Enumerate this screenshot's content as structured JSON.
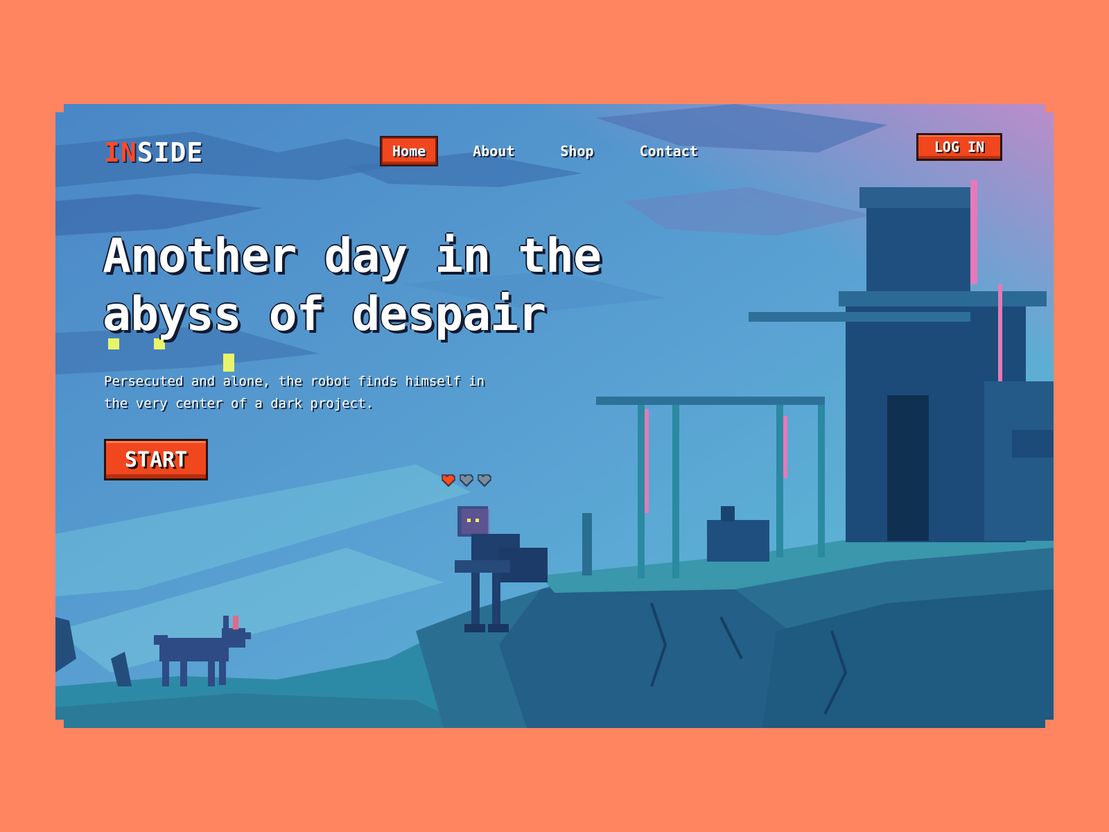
{
  "logo": {
    "accent": "IN",
    "rest": "SIDE"
  },
  "nav": {
    "items": [
      {
        "label": "Home",
        "active": true
      },
      {
        "label": "About",
        "active": false
      },
      {
        "label": "Shop",
        "active": false
      },
      {
        "label": "Contact",
        "active": false
      }
    ]
  },
  "header": {
    "login_label": "LOG IN"
  },
  "hero": {
    "title_line1": "Another day in the",
    "title_line2": "abyss of despair",
    "subtitle_line1": "Persecuted and alone, the robot finds himself in",
    "subtitle_line2": "the very center of a dark project.",
    "start_label": "START"
  },
  "lives": {
    "total": 3,
    "filled": 1
  },
  "colors": {
    "background": "#ff8560",
    "accent": "#f0471f",
    "sky": "#4f8fca",
    "heart_full": "#ff4a1a",
    "heart_empty": "#7a8c9c"
  }
}
